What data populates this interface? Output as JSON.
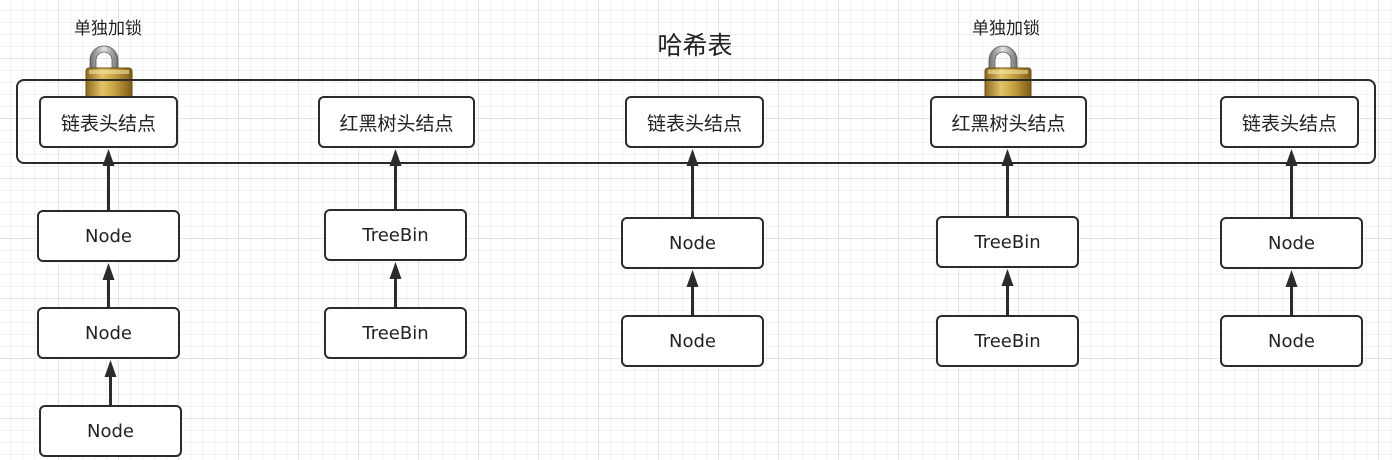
{
  "title": "哈希表",
  "columns": [
    {
      "head": "链表头结点",
      "lock": "单独加锁",
      "nodes": [
        "Node",
        "Node",
        "Node"
      ]
    },
    {
      "head": "红黑树头结点",
      "lock": null,
      "nodes": [
        "TreeBin",
        "TreeBin"
      ]
    },
    {
      "head": "链表头结点",
      "lock": null,
      "nodes": [
        "Node",
        "Node"
      ]
    },
    {
      "head": "红黑树头结点",
      "lock": "单独加锁",
      "nodes": [
        "TreeBin",
        "TreeBin"
      ]
    },
    {
      "head": "链表头结点",
      "lock": null,
      "nodes": [
        "Node",
        "Node"
      ]
    }
  ],
  "colors": {
    "stroke": "#2b2b2b",
    "lock_gold": "#c9a441",
    "lock_shackle": "#9a9a9a"
  },
  "icons": {
    "lock": "padlock-icon"
  }
}
